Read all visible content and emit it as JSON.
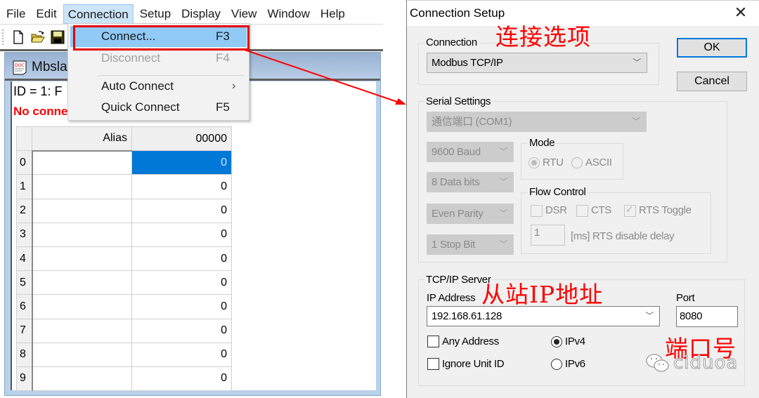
{
  "left_app": {
    "menubar": [
      "File",
      "Edit",
      "Connection",
      "Setup",
      "Display",
      "View",
      "Window",
      "Help"
    ],
    "active_menu": "Connection",
    "child_window_title": "Mbslav",
    "status_id": "ID = 1: F",
    "status_connection": "No conne",
    "connection_menu": {
      "items": [
        {
          "label": "Connect...",
          "shortcut": "F3",
          "state": "highlighted"
        },
        {
          "label": "Disconnect",
          "shortcut": "F4",
          "state": "disabled"
        },
        {
          "label": "Auto Connect",
          "shortcut": "",
          "state": "submenu"
        },
        {
          "label": "Quick Connect",
          "shortcut": "F5",
          "state": "normal"
        }
      ]
    },
    "grid": {
      "columns": [
        "Alias",
        "00000"
      ],
      "rows": [
        {
          "index": "0",
          "alias": "",
          "value": "0"
        },
        {
          "index": "1",
          "alias": "",
          "value": "0"
        },
        {
          "index": "2",
          "alias": "",
          "value": "0"
        },
        {
          "index": "3",
          "alias": "",
          "value": "0"
        },
        {
          "index": "4",
          "alias": "",
          "value": "0"
        },
        {
          "index": "5",
          "alias": "",
          "value": "0"
        },
        {
          "index": "6",
          "alias": "",
          "value": "0"
        },
        {
          "index": "7",
          "alias": "",
          "value": "0"
        },
        {
          "index": "8",
          "alias": "",
          "value": "0"
        },
        {
          "index": "9",
          "alias": "",
          "value": "0"
        }
      ],
      "selected_row": 0
    }
  },
  "dialog": {
    "title": "Connection Setup",
    "close_symbol": "✕",
    "connection": {
      "group_label": "Connection",
      "value": "Modbus TCP/IP"
    },
    "buttons": {
      "ok": "OK",
      "cancel": "Cancel"
    },
    "serial_settings": {
      "group_label": "Serial Settings",
      "port": "通信端口 (COM1)",
      "baud": "9600 Baud",
      "data_bits": "8 Data bits",
      "parity": "Even Parity",
      "stop_bits": "1 Stop Bit",
      "mode": {
        "group_label": "Mode",
        "options": [
          "RTU",
          "ASCII"
        ],
        "selected": "RTU"
      },
      "flow_control": {
        "group_label": "Flow Control",
        "dsr": {
          "label": "DSR",
          "checked": false
        },
        "cts": {
          "label": "CTS",
          "checked": false
        },
        "rts_toggle": {
          "label": "RTS Toggle",
          "checked": true
        },
        "rts_delay_value": "1",
        "rts_delay_label": "[ms] RTS disable delay"
      }
    },
    "tcpip": {
      "group_label": "TCP/IP Server",
      "ip_label": "IP Address",
      "ip_value": "192.168.61.128",
      "port_label": "Port",
      "port_value": "8080",
      "any_address": {
        "label": "Any Address",
        "checked": false
      },
      "ignore_unit_id": {
        "label": "Ignore Unit ID",
        "checked": false
      },
      "ip_versions": [
        "IPv4",
        "IPv6"
      ],
      "ip_version_selected": "IPv4"
    }
  },
  "annotations": {
    "connection_option": "连接选项",
    "slave_ip": "从站IP地址",
    "port_number": "端口号",
    "color": "#ff0000"
  },
  "watermark": {
    "text": "ciduoa",
    "icon": "wechat-icon"
  }
}
